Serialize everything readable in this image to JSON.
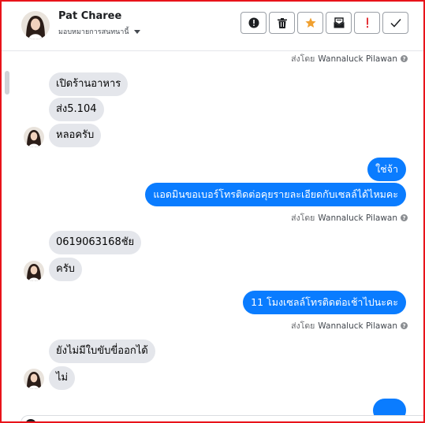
{
  "header": {
    "contact_name": "Pat Charee",
    "assign_label": "มอบหมายการสนทนานี้"
  },
  "actions": [
    {
      "name": "report-button",
      "icon": "alert-circle-icon"
    },
    {
      "name": "delete-button",
      "icon": "trash-icon"
    },
    {
      "name": "star-button",
      "icon": "star-icon",
      "color": "#f0a030"
    },
    {
      "name": "archive-button",
      "icon": "mailbox-icon"
    },
    {
      "name": "spam-button",
      "icon": "exclamation-icon",
      "color": "#e4343a"
    },
    {
      "name": "done-button",
      "icon": "check-icon"
    }
  ],
  "messages": {
    "sent_by_prefix": "ส่งโดย",
    "agent_name": "Wannaluck Pilawan",
    "in1": "เปิดร้านอาหาร",
    "in2": "ส่ง5.104",
    "in3": "หลอครับ",
    "out1": "ใช่จ้า",
    "out2": "แอดมินขอเบอร์โทรติดต่อคุยรายละเอียดกับเซลล์ได้ไหมคะ",
    "in4": "0619063168ชัย",
    "in5": "ครับ",
    "out3": "11 โมงเซลล์โทรติดต่อเช้าไปนะคะ",
    "in6": "ยังไม่มีใบขับขี่ออกได้",
    "in7": "ไม่"
  },
  "colors": {
    "outgoing_bubble": "#0a7cff",
    "incoming_bubble": "#e4e6eb",
    "frame_border": "#e8141a"
  }
}
